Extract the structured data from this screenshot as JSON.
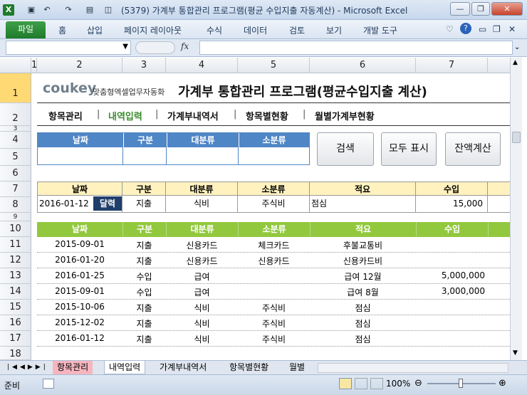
{
  "window": {
    "title": "(5379) 가계부 통합관리 프로그램(평균 수입지출 자동계산)  -  Microsoft Excel",
    "minimize": "—",
    "restore": "❐",
    "close": "✕"
  },
  "ribbon": {
    "file_tab": "파일",
    "tabs": [
      "홈",
      "삽입",
      "페이지 레이아웃",
      "수식",
      "데이터",
      "검토",
      "보기",
      "개발 도구"
    ]
  },
  "formula_bar": {
    "fx": "fx"
  },
  "columns": [
    "1",
    "2",
    "3",
    "4",
    "5",
    "6",
    "7"
  ],
  "rows": [
    "1",
    "2",
    "3",
    "4",
    "5",
    "6",
    "7",
    "8",
    "9",
    "10",
    "11",
    "12",
    "13",
    "14",
    "15",
    "16",
    "17",
    "18"
  ],
  "logo": {
    "brand": "coukey",
    "tagline": "맞춤형엑셀업무자동화"
  },
  "page_title": "가계부 통합관리 프로그램(평균수입지출 계산)",
  "nav": [
    "항목관리",
    "내역입력",
    "가계부내역서",
    "항목별현황",
    "월별가계부현황"
  ],
  "search_form": {
    "headers": [
      "날짜",
      "구분",
      "대분류",
      "소분류"
    ]
  },
  "buttons": {
    "search": "검색",
    "show_all": "모두 표시",
    "balance": "잔액계산"
  },
  "entry_form": {
    "headers": [
      "날짜",
      "구분",
      "대분류",
      "소분류",
      "적요",
      "수입"
    ],
    "values": {
      "date": "2016-01-12",
      "calendar": "달력",
      "type": "지출",
      "major": "식비",
      "minor": "주식비",
      "memo": "점심",
      "income": "15,000"
    }
  },
  "list": {
    "headers": [
      "날짜",
      "구분",
      "대분류",
      "소분류",
      "적요",
      "수입"
    ],
    "rows": [
      {
        "date": "2015-09-01",
        "type": "지출",
        "major": "신용카드",
        "minor": "체크카드",
        "memo": "후불교통비",
        "income": ""
      },
      {
        "date": "2016-01-20",
        "type": "지출",
        "major": "신용카드",
        "minor": "신용카드",
        "memo": "신용카드비",
        "income": ""
      },
      {
        "date": "2016-01-25",
        "type": "수입",
        "major": "급여",
        "minor": "",
        "memo": "급여 12월",
        "income": "5,000,000"
      },
      {
        "date": "2015-09-01",
        "type": "수입",
        "major": "급여",
        "minor": "",
        "memo": "급여 8월",
        "income": "3,000,000"
      },
      {
        "date": "2015-10-06",
        "type": "지출",
        "major": "식비",
        "minor": "주식비",
        "memo": "점심",
        "income": ""
      },
      {
        "date": "2015-12-02",
        "type": "지출",
        "major": "식비",
        "minor": "주식비",
        "memo": "점심",
        "income": ""
      },
      {
        "date": "2016-01-12",
        "type": "지출",
        "major": "식비",
        "minor": "주식비",
        "memo": "점심",
        "income": ""
      }
    ]
  },
  "sheet_tabs": [
    "항목관리",
    "내역입력",
    "가계부내역서",
    "항목별현황",
    "월별"
  ],
  "status": {
    "ready": "준비",
    "zoom": "100%"
  },
  "colors": {
    "excel_green": "#1e7b2a",
    "accent_blue": "#4f86c6",
    "accent_green": "#92c83e",
    "yellow_header": "#fff2bf"
  }
}
